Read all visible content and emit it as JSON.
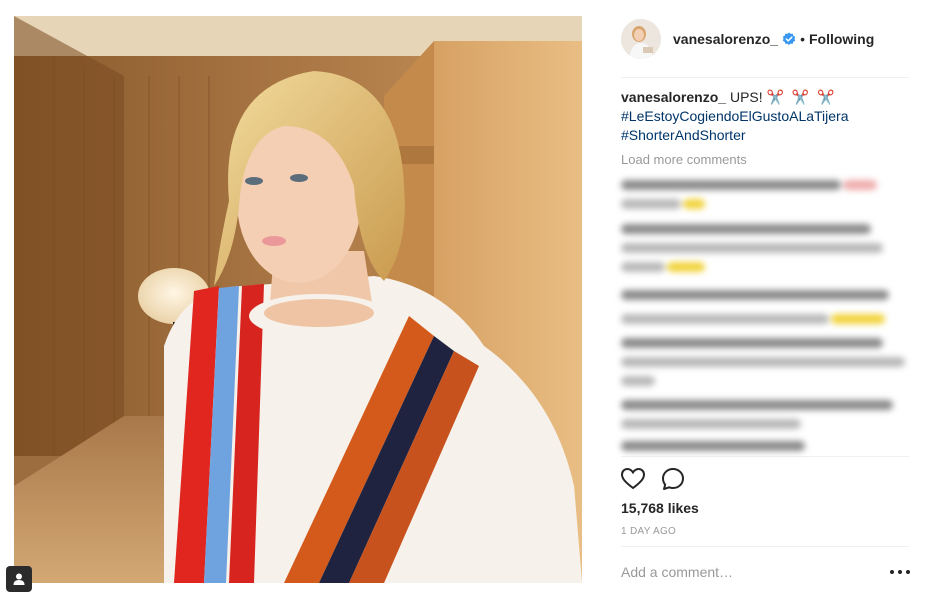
{
  "post": {
    "username": "vanesalorenzo_",
    "verified": true,
    "separator": "•",
    "follow_status": "Following",
    "caption_text": "UPS!",
    "caption_emoji": "✂️ ✂️ ✂️",
    "hashtags": [
      "#LeEstoyCogiendoElGustoALaTijera",
      "#ShorterAndShorter"
    ],
    "load_more": "Load more comments",
    "likes": "15,768 likes",
    "time": "1 DAY AGO",
    "comment_placeholder": "Add a comment…"
  },
  "icons": {
    "verified": "verified-badge-icon",
    "like": "heart-icon",
    "comment": "comment-bubble-icon",
    "more": "more-options-icon",
    "tag": "user-tag-icon"
  },
  "colors": {
    "text": "#262626",
    "muted": "#999999",
    "hashtag": "#003569",
    "verified_blue": "#3897f0",
    "divider": "#efefef"
  }
}
